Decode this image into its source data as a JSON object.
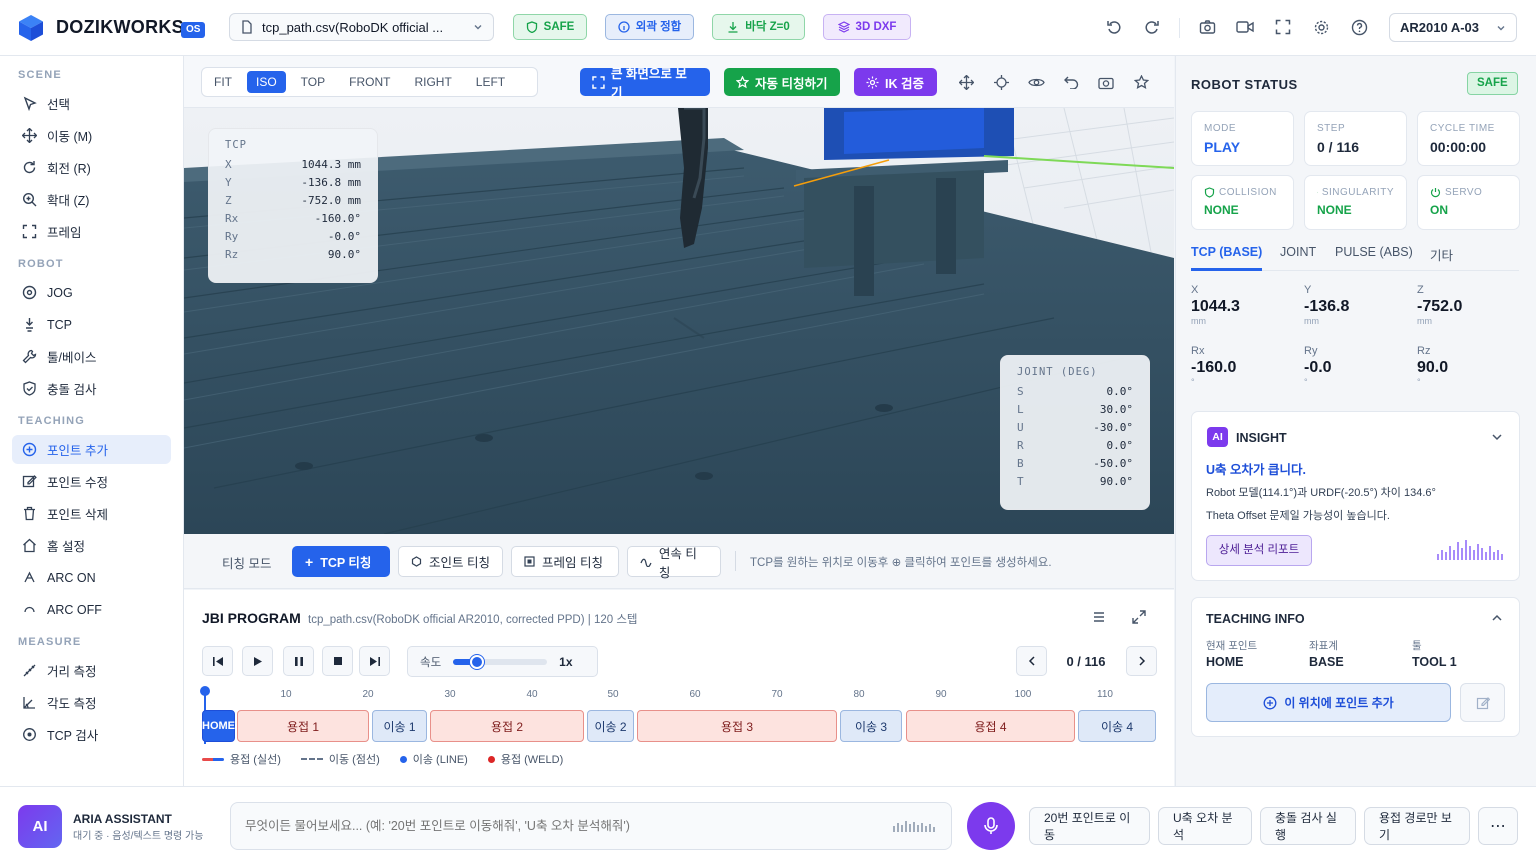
{
  "header": {
    "brand": "DOZIKWORKS",
    "brand_badge": "OS",
    "file_select": "tcp_path.csv(RoboDK official ...",
    "pills": [
      {
        "label": "SAFE",
        "icon": "shield-icon",
        "color": "#16a34a"
      },
      {
        "label": "외곽 정합",
        "icon": "info-circle-icon",
        "color": "#2563eb"
      },
      {
        "label": "바닥 Z=0",
        "icon": "download-icon",
        "color": "#16a34a"
      },
      {
        "label": "3D DXF",
        "icon": "layers-icon",
        "color": "#7c3aed"
      }
    ],
    "model_select": "AR2010 A-03"
  },
  "sidebar": {
    "sections": [
      {
        "title": "SCENE",
        "items": [
          {
            "label": "선택",
            "icon": "cursor-icon"
          },
          {
            "label": "이동 (M)",
            "icon": "move-icon"
          },
          {
            "label": "회전 (R)",
            "icon": "rotate-icon"
          },
          {
            "label": "확대 (Z)",
            "icon": "zoom-icon"
          },
          {
            "label": "프레임",
            "icon": "frame-icon"
          }
        ]
      },
      {
        "title": "ROBOT",
        "items": [
          {
            "label": "JOG",
            "icon": "target-icon"
          },
          {
            "label": "TCP",
            "icon": "tcp-icon"
          },
          {
            "label": "툴/베이스",
            "icon": "wrench-icon"
          },
          {
            "label": "충돌 검사",
            "icon": "shield-check-icon"
          }
        ]
      },
      {
        "title": "TEACHING",
        "items": [
          {
            "label": "포인트 추가",
            "icon": "plus-circle-icon",
            "active": true
          },
          {
            "label": "포인트 수정",
            "icon": "edit-icon"
          },
          {
            "label": "포인트 삭제",
            "icon": "trash-icon"
          },
          {
            "label": "홈 설정",
            "icon": "home-icon"
          },
          {
            "label": "ARC ON",
            "icon": "arc-on-icon"
          },
          {
            "label": "ARC OFF",
            "icon": "arc-off-icon"
          }
        ]
      },
      {
        "title": "MEASURE",
        "items": [
          {
            "label": "거리 측정",
            "icon": "ruler-icon"
          },
          {
            "label": "각도 측정",
            "icon": "angle-icon"
          },
          {
            "label": "TCP 검사",
            "icon": "crosshair-icon"
          }
        ]
      }
    ]
  },
  "viewport": {
    "views": [
      "FIT",
      "ISO",
      "TOP",
      "FRONT",
      "RIGHT",
      "LEFT"
    ],
    "active_view": "ISO",
    "fullscreen_label": "큰 화면으로 보기",
    "auto_teach_label": "자동 티칭하기",
    "ik_label": "IK 검증",
    "tcp_panel": {
      "title": "TCP",
      "rows": [
        {
          "k": "X",
          "v": "1044.3 mm"
        },
        {
          "k": "Y",
          "v": "-136.8 mm"
        },
        {
          "k": "Z",
          "v": "-752.0 mm"
        },
        {
          "k": "Rx",
          "v": "-160.0°"
        },
        {
          "k": "Ry",
          "v": "-0.0°"
        },
        {
          "k": "Rz",
          "v": "90.0°"
        }
      ]
    },
    "joint_panel": {
      "title": "JOINT (DEG)",
      "rows": [
        {
          "k": "S",
          "v": "0.0°"
        },
        {
          "k": "L",
          "v": "30.0°"
        },
        {
          "k": "U",
          "v": "-30.0°"
        },
        {
          "k": "R",
          "v": "0.0°"
        },
        {
          "k": "B",
          "v": "-50.0°"
        },
        {
          "k": "T",
          "v": "90.0°"
        }
      ]
    }
  },
  "teach_bar": {
    "mode_label": "티칭 모드",
    "buttons": [
      "TCP 티칭",
      "조인트 티칭",
      "프레임 티칭",
      "연속 티칭"
    ],
    "hint": "TCP를 원하는 위치로 이동후 ⊕ 클릭하여 포인트를 생성하세요."
  },
  "program": {
    "title": "JBI PROGRAM",
    "subtitle": "tcp_path.csv(RoboDK official AR2010, corrected PPD) | 120 스텝",
    "speed_label": "속도",
    "speed_value": "1x",
    "speed_fraction": 0.25,
    "step_counter": "0 / 116",
    "ticks": [
      "10",
      "20",
      "30",
      "40",
      "50",
      "60",
      "70",
      "80",
      "90",
      "100",
      "110"
    ],
    "segments": [
      {
        "label": "HOME",
        "type": "home"
      },
      {
        "label": "용접 1",
        "type": "weld"
      },
      {
        "label": "이송 1",
        "type": "move"
      },
      {
        "label": "용접 2",
        "type": "weld"
      },
      {
        "label": "이송 2",
        "type": "move"
      },
      {
        "label": "용접 3",
        "type": "weld"
      },
      {
        "label": "이송 3",
        "type": "move"
      },
      {
        "label": "용접 4",
        "type": "weld"
      },
      {
        "label": "이송 4",
        "type": "move"
      }
    ],
    "legend": [
      "용접 (실선)",
      "이동 (점선)",
      "이송 (LINE)",
      "용접 (WELD)"
    ]
  },
  "robot_status": {
    "title": "ROBOT STATUS",
    "badge": "SAFE",
    "stats": [
      {
        "label": "MODE",
        "value": "PLAY",
        "color": "#2563eb"
      },
      {
        "label": "STEP",
        "value": "0 / 116",
        "color": "#1e293b"
      },
      {
        "label": "CYCLE TIME",
        "value": "00:00:00",
        "color": "#1e293b"
      },
      {
        "label": "COLLISION",
        "value": "NONE",
        "color": "#16a34a",
        "icon": "shield-icon"
      },
      {
        "label": "SINGULARITY",
        "value": "NONE",
        "color": "#16a34a",
        "icon": "check-circle-icon"
      },
      {
        "label": "SERVO",
        "value": "ON",
        "color": "#16a34a",
        "icon": "power-icon"
      }
    ],
    "tabs": [
      "TCP (BASE)",
      "JOINT",
      "PULSE (ABS)",
      "기타"
    ],
    "active_tab": 0,
    "coords": [
      {
        "label": "X",
        "value": "1044.3",
        "unit": "mm"
      },
      {
        "label": "Y",
        "value": "-136.8",
        "unit": "mm"
      },
      {
        "label": "Z",
        "value": "-752.0",
        "unit": "mm"
      },
      {
        "label": "Rx",
        "value": "-160.0",
        "unit": "°"
      },
      {
        "label": "Ry",
        "value": "-0.0",
        "unit": "°"
      },
      {
        "label": "Rz",
        "value": "90.0",
        "unit": "°"
      }
    ]
  },
  "insight": {
    "badge": "AI",
    "title": "INSIGHT",
    "headline": "U축 오차가 큽니다.",
    "line1": "Robot 모델(114.1°)과 URDF(-20.5°) 차이 134.6°",
    "line2": "Theta Offset 문제일 가능성이 높습니다.",
    "button": "상세 분석 리포트"
  },
  "teaching_info": {
    "title": "TEACHING INFO",
    "cols": [
      {
        "label": "현재 포인트",
        "value": "HOME"
      },
      {
        "label": "좌표계",
        "value": "BASE"
      },
      {
        "label": "툴",
        "value": "TOOL 1"
      }
    ],
    "add_button": "이 위치에 포인트 추가"
  },
  "assistant": {
    "avatar": "AI",
    "name": "ARIA ASSISTANT",
    "status": "대기 중 · 음성/텍스트 명령 가능",
    "placeholder": "무엇이든 물어보세요... (예: '20번 포인트로 이동해줘', 'U축 오차 분석해줘')",
    "quick": [
      "20번 포인트로 이동",
      "U축 오차 분석",
      "충돌 검사 실행",
      "용접 경로만 보기"
    ],
    "more": "⋯"
  }
}
